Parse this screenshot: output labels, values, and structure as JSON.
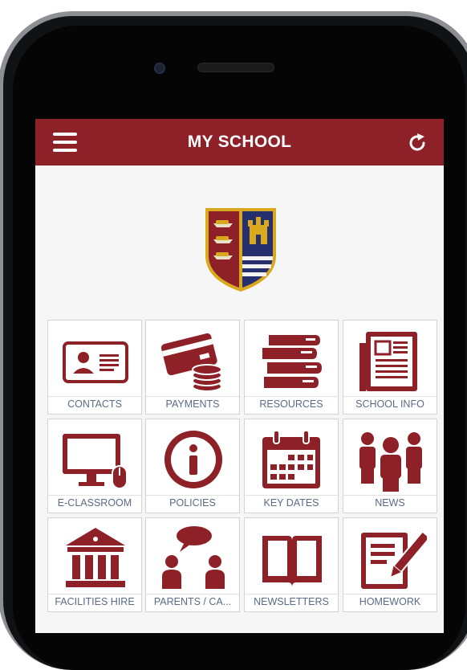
{
  "app": {
    "title": "MY SCHOOL"
  },
  "colors": {
    "brand": "#8e2127",
    "tile_label": "#5a6b86",
    "crest_navy": "#27306e",
    "crest_gold": "#d9a81c"
  },
  "icons": {
    "menu": "hamburger-icon",
    "refresh": "refresh-icon",
    "crest": "school-crest"
  },
  "tiles": [
    {
      "label": "CONTACTS",
      "icon": "contact-card-icon"
    },
    {
      "label": "PAYMENTS",
      "icon": "payment-card-coins-icon"
    },
    {
      "label": "RESOURCES",
      "icon": "books-icon"
    },
    {
      "label": "SCHOOL INFO",
      "icon": "newspaper-icon"
    },
    {
      "label": "E-CLASSROOM",
      "icon": "computer-icon"
    },
    {
      "label": "POLICIES",
      "icon": "info-icon"
    },
    {
      "label": "KEY DATES",
      "icon": "calendar-icon"
    },
    {
      "label": "NEWS",
      "icon": "people-group-icon"
    },
    {
      "label": "FACILITIES HIRE",
      "icon": "building-icon"
    },
    {
      "label": "PARENTS / CA...",
      "icon": "conversation-icon"
    },
    {
      "label": "NEWSLETTERS",
      "icon": "open-book-icon"
    },
    {
      "label": "HOMEWORK",
      "icon": "homework-icon"
    }
  ]
}
